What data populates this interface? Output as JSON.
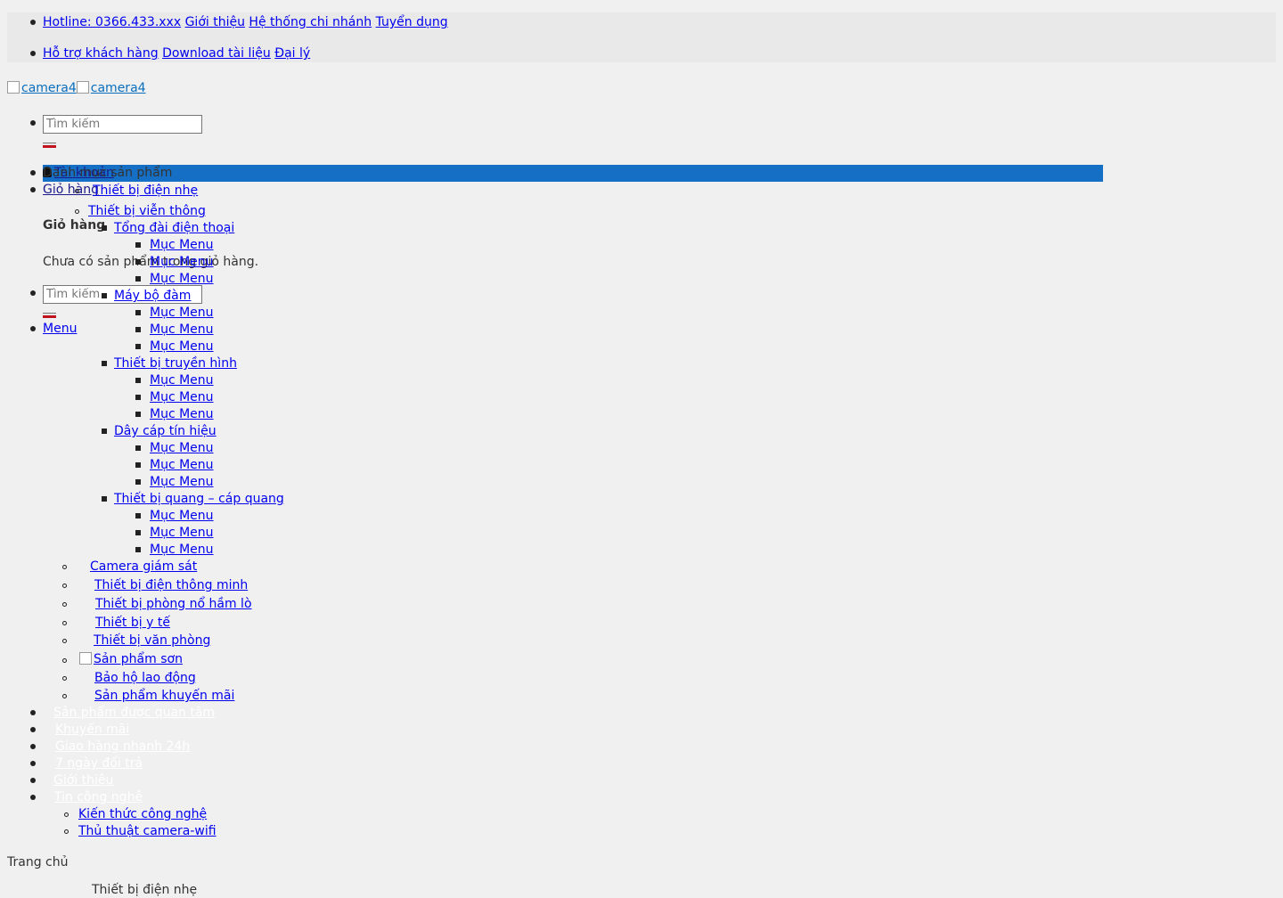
{
  "topbar": {
    "hotline": "Hotline: 0366.433.xxx",
    "links_row1": [
      "Giới thiệu",
      "Hệ thống chi nhánh",
      "Tuyển dụng"
    ],
    "links_row2": [
      "Hỗ trợ khách hàng",
      "Download tài liệu",
      "Đại lý"
    ]
  },
  "logo": {
    "alt_1": "camera4",
    "alt_2": "camera4"
  },
  "search": {
    "placeholder": "Tìm kiếm"
  },
  "account": {
    "label": "Tài khoản",
    "cart_link": "Giỏ hàng"
  },
  "cart": {
    "title": "Giỏ hàng",
    "empty_message": "Chưa có sản phẩm trong giỏ hàng."
  },
  "mobile_search": {
    "placeholder": "Tìm kiếm"
  },
  "menu_toggle": "Menu",
  "categories": {
    "heading": "Danh mục sản phẩm",
    "items": {
      "dien_nhe": "Thiết bị điện nhẹ",
      "vien_thong": "Thiết bị viễn thông",
      "tong_dai": "Tổng đài điện thoại",
      "may_bo_dam": "Máy bộ đàm",
      "truyen_hinh": "Thiết bị truyền hình",
      "day_cap": "Dây cáp tín hiệu",
      "quang": "Thiết bị quang – cáp quang",
      "camera": "Camera giám sát",
      "thong_minh": "Thiết bị điện thông minh",
      "phong_no": "Thiết bị phòng nổ hầm lò",
      "y_te": "Thiết bị y tế",
      "van_phong": "Thiết bị văn phòng",
      "son": "Sản phẩm sơn",
      "bao_ho": "Bảo hộ lao động",
      "khuyen_mai_sp": "Sản phẩm khuyến mãi"
    },
    "submenu_item": "Mục Menu"
  },
  "main_nav": {
    "items": [
      "Sản phẩm được quan tâm",
      "Khuyến mãi",
      "Giao hàng nhanh 24h",
      "7 ngày đổi trả",
      "Giới thiệu",
      "Tin công nghệ"
    ],
    "sub": [
      "Kiến thức công nghệ",
      "Thủ thuật camera-wifi"
    ]
  },
  "breadcrumb": {
    "home": "Trang chủ",
    "current": "Thiết bị điện nhẹ"
  }
}
